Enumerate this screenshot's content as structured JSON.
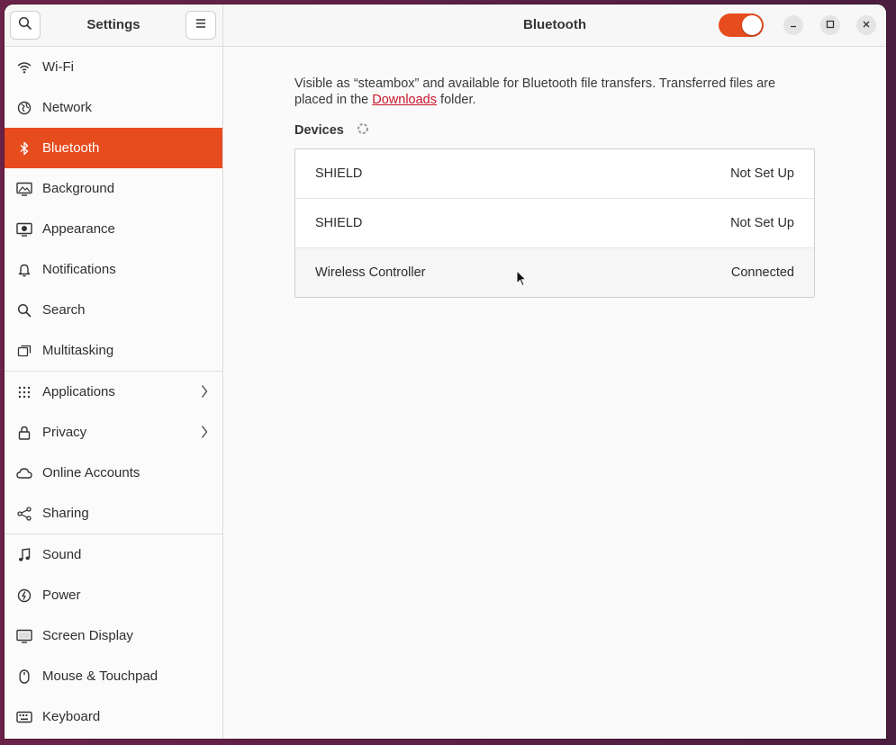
{
  "sidebar": {
    "title": "Settings",
    "items": [
      {
        "label": "Wi-Fi",
        "icon": "wifi-icon"
      },
      {
        "label": "Network",
        "icon": "network-icon"
      },
      {
        "label": "Bluetooth",
        "icon": "bluetooth-icon",
        "active": true
      },
      {
        "label": "Background",
        "icon": "background-icon"
      },
      {
        "label": "Appearance",
        "icon": "appearance-icon"
      },
      {
        "label": "Notifications",
        "icon": "bell-icon"
      },
      {
        "label": "Search",
        "icon": "search-icon"
      },
      {
        "label": "Multitasking",
        "icon": "multitasking-icon"
      },
      {
        "label": "Applications",
        "icon": "apps-grid-icon",
        "has_submenu": true
      },
      {
        "label": "Privacy",
        "icon": "lock-icon",
        "has_submenu": true
      },
      {
        "label": "Online Accounts",
        "icon": "cloud-icon"
      },
      {
        "label": "Sharing",
        "icon": "share-icon"
      },
      {
        "label": "Sound",
        "icon": "music-note-icon"
      },
      {
        "label": "Power",
        "icon": "power-icon"
      },
      {
        "label": "Screen Display",
        "icon": "display-icon"
      },
      {
        "label": "Mouse & Touchpad",
        "icon": "mouse-icon"
      },
      {
        "label": "Keyboard",
        "icon": "keyboard-icon"
      }
    ]
  },
  "header": {
    "title": "Bluetooth",
    "bluetooth_enabled": true
  },
  "main": {
    "description_before": "Visible as “steambox” and available for Bluetooth file transfers. Transferred files are placed in the ",
    "description_link": "Downloads",
    "description_after": " folder.",
    "devices_label": "Devices",
    "devices": [
      {
        "name": "SHIELD",
        "status": "Not Set Up"
      },
      {
        "name": "SHIELD",
        "status": "Not Set Up"
      },
      {
        "name": "Wireless Controller",
        "status": "Connected"
      }
    ]
  },
  "colors": {
    "accent": "#e74c1f",
    "link": "#c7162b",
    "desktop": "#5a1f45"
  }
}
